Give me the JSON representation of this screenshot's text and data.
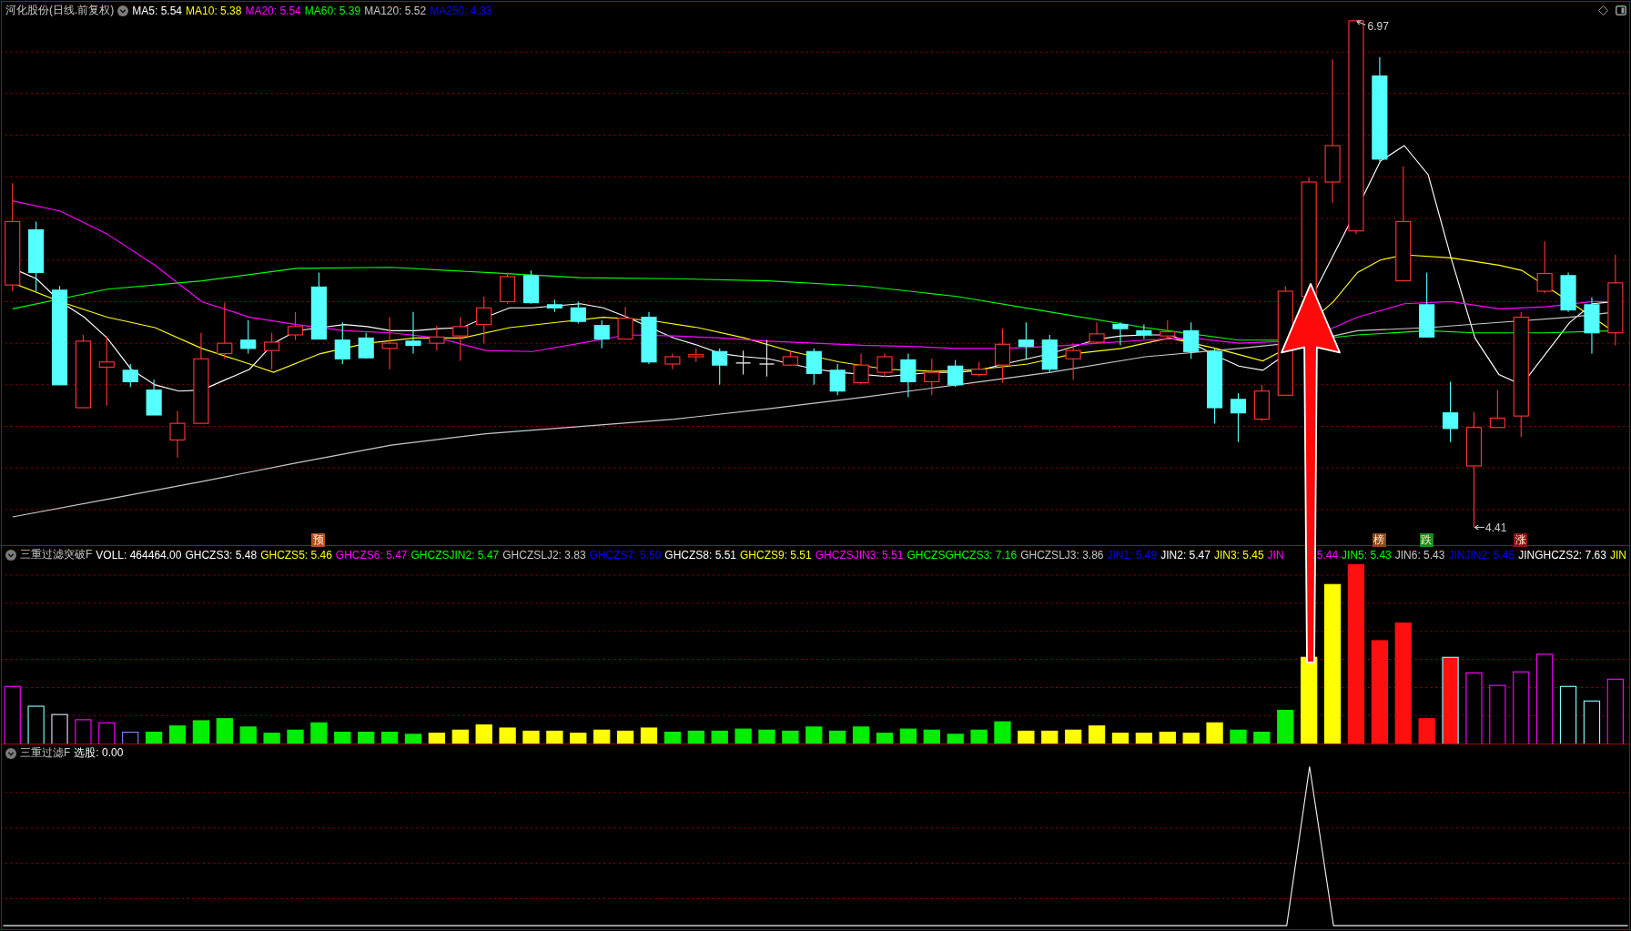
{
  "main_panel": {
    "title": "河化股份(日线.前复权)",
    "indicators": [
      {
        "text": "MA5: 5.54",
        "color": "#ffffff"
      },
      {
        "text": "MA10: 5.38",
        "color": "#ffff00"
      },
      {
        "text": "MA20: 5.54",
        "color": "#ff00ff"
      },
      {
        "text": "MA60: 5.39",
        "color": "#00ff00"
      },
      {
        "text": "MA120: 5.52",
        "color": "#c8c8c8"
      },
      {
        "text": "MA250: 4.33",
        "color": "#0000ff"
      }
    ],
    "high_label": "6.97",
    "low_label": "4.41",
    "markers": [
      {
        "text": "预",
        "color": "#b4501e"
      },
      {
        "text": "榜",
        "color": "#8c4a14"
      },
      {
        "text": "跌",
        "color": "#1e8c1e"
      },
      {
        "text": "涨",
        "color": "#8c1414"
      }
    ]
  },
  "volume_panel": {
    "title": "三重过滤突破F",
    "indicators": [
      {
        "text": "VOLL: 464464.00",
        "color": "#ffffff"
      },
      {
        "text": "GHCZS3: 5.48",
        "color": "#ffffff"
      },
      {
        "text": "GHCZS5: 5.46",
        "color": "#ffff00"
      },
      {
        "text": "GHCZS6: 5.47",
        "color": "#ff00ff"
      },
      {
        "text": "GHCZSJIN2: 5.47",
        "color": "#00ff00"
      },
      {
        "text": "GHCZSLJ2: 3.83",
        "color": "#c8c8c8"
      },
      {
        "text": "GHCZS7: 5.50",
        "color": "#0000ff"
      },
      {
        "text": "GHCZS8: 5.51",
        "color": "#ffffff"
      },
      {
        "text": "GHCZS9: 5.51",
        "color": "#ffff00"
      },
      {
        "text": "GHCZSJIN3: 5.51",
        "color": "#ff00ff"
      },
      {
        "text": "GHCZSGHCZS3: 7.16",
        "color": "#00ff00"
      },
      {
        "text": "GHCZSLJ3: 3.86",
        "color": "#c8c8c8"
      },
      {
        "text": "JIN1: 5.49",
        "color": "#0000ff"
      },
      {
        "text": "JIN2: 5.47",
        "color": "#ffffff"
      },
      {
        "text": "JIN3: 5.45",
        "color": "#ffff00"
      },
      {
        "text": "JIN",
        "color": "#ff00ff"
      },
      {
        "text": "5.44",
        "color": "#ff00ff"
      },
      {
        "text": "JIN5: 5.43",
        "color": "#00ff00"
      },
      {
        "text": "JIN6: 5.43",
        "color": "#c8c8c8"
      },
      {
        "text": "JINJIN2: 5.45",
        "color": "#0000ff"
      },
      {
        "text": "JINGHCZS2: 7.63",
        "color": "#ffffff"
      },
      {
        "text": "JIN",
        "color": "#ffff00"
      }
    ]
  },
  "signal_panel": {
    "title": "三重过滤F",
    "indicators": [
      {
        "text": "选股: 0.00",
        "color": "#ffffff"
      }
    ]
  }
}
